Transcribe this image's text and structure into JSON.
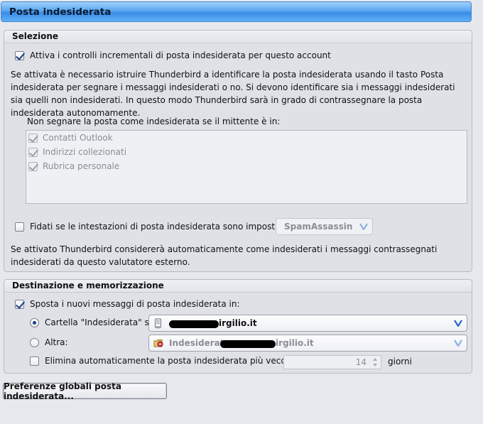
{
  "header": {
    "title": "Posta indesiderata"
  },
  "selezione": {
    "title": "Selezione",
    "enable_label": "Attiva i controlli incrementali di posta indesiderata per questo account",
    "enable_checked": true,
    "description": "Se attivata è necessario istruire Thunderbird a identificare la posta indesiderata usando il tasto Posta indesiderata per segnare i messaggi indesiderati o no. Si devono identificare sia i messaggi indesiderati sia quelli non indesiderati. In questo modo Thunderbird sarà in grado di contrassegnare la posta indesiderata autonomamente.",
    "whitelist_label": "Non segnare la posta come indesiderata se il mittente è in:",
    "address_books": [
      {
        "label": "Contatti Outlook",
        "checked": true
      },
      {
        "label": "Indirizzi collezionati",
        "checked": true
      },
      {
        "label": "Rubrica personale",
        "checked": true
      }
    ],
    "trust_label": "Fidati se le intestazioni di posta indesiderata sono impostate da:",
    "trust_checked": false,
    "trust_value": "SpamAssassin",
    "trust_description": "Se attivato Thunderbird considererà automaticamente come indesiderati i messaggi contrassegnati indesiderati da questo valutatore esterno."
  },
  "destinazione": {
    "title": "Destinazione e memorizzazione",
    "move_label": "Sposta i nuovi messaggi di posta indesiderata in:",
    "move_checked": true,
    "folder_option_label": "Cartella \"Indesiderata\" su:",
    "folder_option_value": "irgilio.it",
    "other_option_label": "Altra:",
    "other_option_value_prefix": "Indesiderata",
    "other_option_value_suffix": "irgilio.it",
    "purge_label": "Elimina automaticamente la posta indesiderata più vecchia di",
    "purge_checked": false,
    "purge_days": "14",
    "purge_unit": "giorni"
  },
  "global_button": "Preferenze globali posta indesiderata...",
  "colors": {
    "header_blue": "#3a8de6",
    "check_mark": "#1b3f86",
    "dropdown_arrow": "#2a66c8"
  },
  "icons": [
    "checkbox",
    "radio-button",
    "chevron-down-icon",
    "server-icon",
    "folder-icon",
    "spin-up-icon",
    "spin-down-icon"
  ]
}
